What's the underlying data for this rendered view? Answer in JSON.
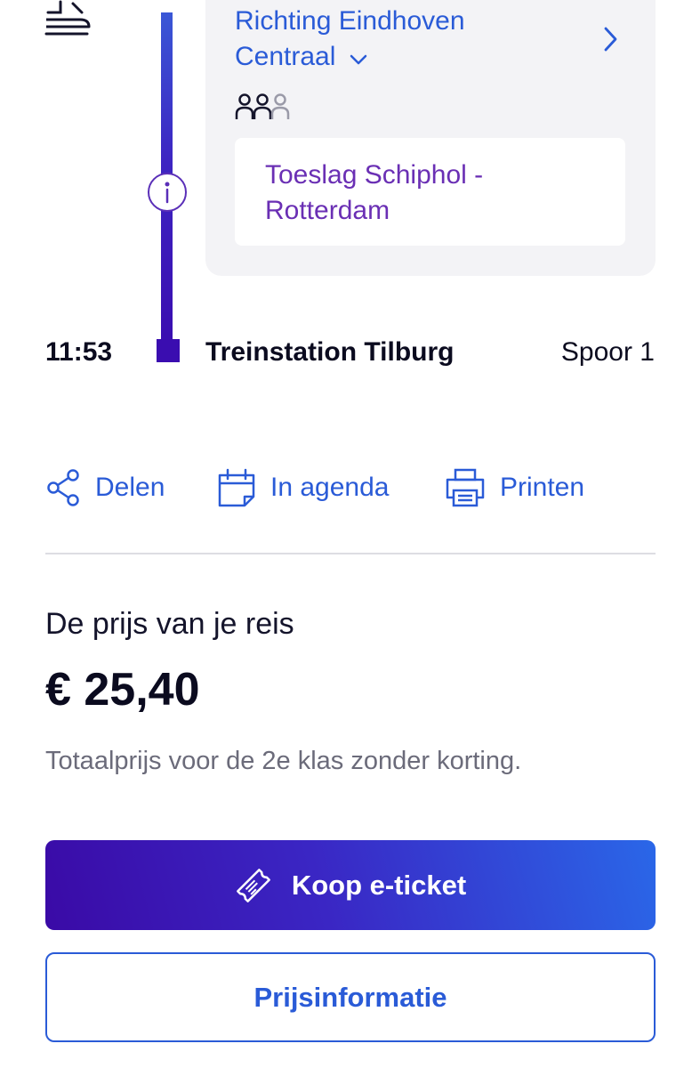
{
  "leg": {
    "direction_line1": "Richting Eindhoven",
    "direction_line2": "Centraal",
    "surcharge_line1": "Toeslag Schiphol -",
    "surcharge_line2": "Rotterdam"
  },
  "arrival": {
    "time": "11:53",
    "station": "Treinstation Tilburg",
    "platform": "Spoor 1"
  },
  "actions": {
    "share": "Delen",
    "calendar": "In agenda",
    "print": "Printen"
  },
  "price": {
    "label": "De prijs van je reis",
    "amount": "€ 25,40",
    "note": "Totaalprijs voor de 2e klas zonder korting."
  },
  "buttons": {
    "buy": "Koop e-ticket",
    "price_info": "Prijsinformatie"
  },
  "icons": {
    "train": "train-icon",
    "info": "info-icon",
    "people": "people-icon",
    "share": "share-icon",
    "calendar": "calendar-icon",
    "print": "printer-icon",
    "ticket": "ticket-icon"
  },
  "colors": {
    "link": "#2a5bd7",
    "surcharge": "#6a2fb4",
    "route_line": "#3a0db0",
    "button_gradient_start": "#3a0aa6",
    "button_gradient_end": "#2a67e8"
  }
}
